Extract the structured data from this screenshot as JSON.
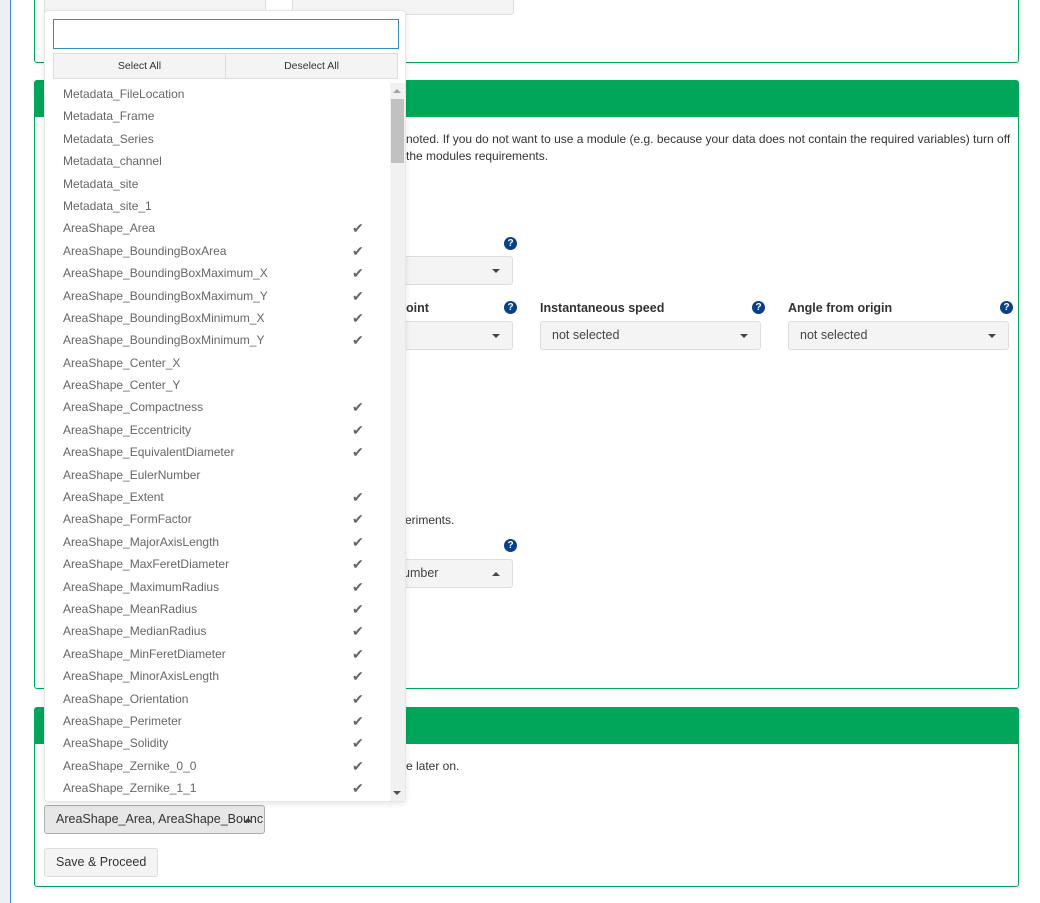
{
  "intro_text": {
    "line1": "noted. If you do not want to use a module (e.g. because your data does not contain the required variables) turn off",
    "line2": "the modules requirements."
  },
  "fields": {
    "top_select": {
      "value": ""
    },
    "point_label": "oint",
    "point_value": "",
    "speed_label": "Instantaneous speed",
    "speed_value": "not selected",
    "angle_label": "Angle from origin",
    "angle_value": "not selected",
    "experiments_text": "eriments.",
    "number_value": "umber"
  },
  "section3": {
    "text": "e later on.",
    "multiselect_value": "AreaShape_Area, AreaShape_Bounc",
    "save_label": "Save & Proceed"
  },
  "dropdown": {
    "search_value": "",
    "select_all": "Select All",
    "deselect_all": "Deselect All",
    "items": [
      {
        "label": "Metadata_FileLocation",
        "checked": false
      },
      {
        "label": "Metadata_Frame",
        "checked": false
      },
      {
        "label": "Metadata_Series",
        "checked": false
      },
      {
        "label": "Metadata_channel",
        "checked": false
      },
      {
        "label": "Metadata_site",
        "checked": false
      },
      {
        "label": "Metadata_site_1",
        "checked": false
      },
      {
        "label": "AreaShape_Area",
        "checked": true
      },
      {
        "label": "AreaShape_BoundingBoxArea",
        "checked": true
      },
      {
        "label": "AreaShape_BoundingBoxMaximum_X",
        "checked": true
      },
      {
        "label": "AreaShape_BoundingBoxMaximum_Y",
        "checked": true
      },
      {
        "label": "AreaShape_BoundingBoxMinimum_X",
        "checked": true
      },
      {
        "label": "AreaShape_BoundingBoxMinimum_Y",
        "checked": true
      },
      {
        "label": "AreaShape_Center_X",
        "checked": false
      },
      {
        "label": "AreaShape_Center_Y",
        "checked": false
      },
      {
        "label": "AreaShape_Compactness",
        "checked": true
      },
      {
        "label": "AreaShape_Eccentricity",
        "checked": true
      },
      {
        "label": "AreaShape_EquivalentDiameter",
        "checked": true
      },
      {
        "label": "AreaShape_EulerNumber",
        "checked": false
      },
      {
        "label": "AreaShape_Extent",
        "checked": true
      },
      {
        "label": "AreaShape_FormFactor",
        "checked": true
      },
      {
        "label": "AreaShape_MajorAxisLength",
        "checked": true
      },
      {
        "label": "AreaShape_MaxFeretDiameter",
        "checked": true
      },
      {
        "label": "AreaShape_MaximumRadius",
        "checked": true
      },
      {
        "label": "AreaShape_MeanRadius",
        "checked": true
      },
      {
        "label": "AreaShape_MedianRadius",
        "checked": true
      },
      {
        "label": "AreaShape_MinFeretDiameter",
        "checked": true
      },
      {
        "label": "AreaShape_MinorAxisLength",
        "checked": true
      },
      {
        "label": "AreaShape_Orientation",
        "checked": true
      },
      {
        "label": "AreaShape_Perimeter",
        "checked": true
      },
      {
        "label": "AreaShape_Solidity",
        "checked": true
      },
      {
        "label": "AreaShape_Zernike_0_0",
        "checked": true
      },
      {
        "label": "AreaShape_Zernike_1_1",
        "checked": true
      }
    ]
  },
  "colors": {
    "accent": "#00a65a",
    "help": "#0a3f8a",
    "focus": "#3c8dbc"
  }
}
